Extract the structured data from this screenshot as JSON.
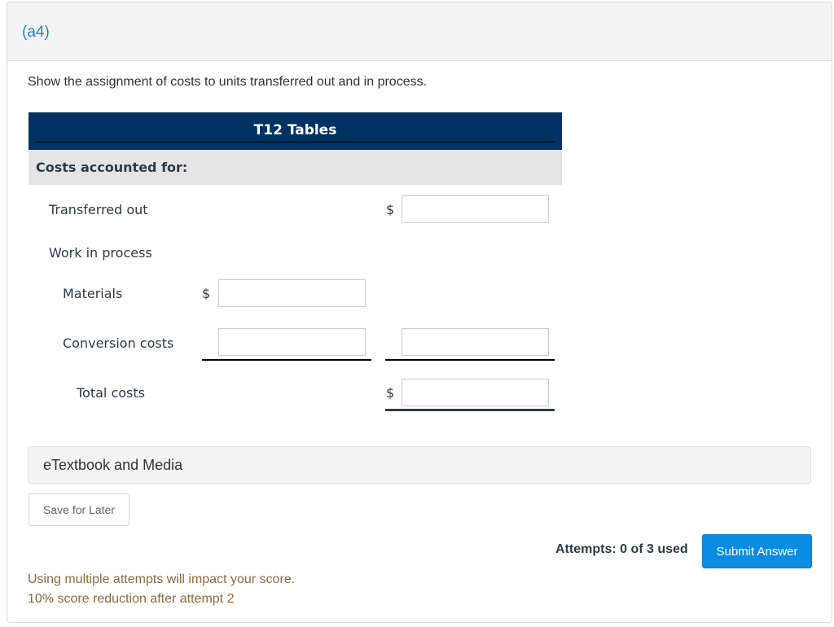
{
  "header": {
    "part_label": "(a4)"
  },
  "prompt": "Show the assignment of costs to units transferred out and in process.",
  "table": {
    "title": "T12 Tables",
    "section_label": "Costs accounted for:",
    "rows": {
      "transferred_out": {
        "label": "Transferred out",
        "currency": "$",
        "value": ""
      },
      "work_in_process": {
        "label": "Work in process"
      },
      "materials": {
        "label": "Materials",
        "currency": "$",
        "value": ""
      },
      "conversion_costs": {
        "label": "Conversion costs",
        "value": "",
        "wip_total_value": ""
      },
      "total_costs": {
        "label": "Total costs",
        "currency": "$",
        "value": ""
      }
    }
  },
  "etextbook": {
    "label": "eTextbook and Media"
  },
  "actions": {
    "save_label": "Save for Later",
    "attempts_text": "Attempts: 0 of 3 used",
    "submit_label": "Submit Answer"
  },
  "warning": {
    "line1": "Using multiple attempts will impact your score.",
    "line2": "10% score reduction after attempt 2"
  },
  "colors": {
    "accent_blue": "#1e88d6",
    "table_header_bg": "#003263",
    "submit_bg": "#0a8ce3",
    "warning_text": "#8b6c3f"
  }
}
